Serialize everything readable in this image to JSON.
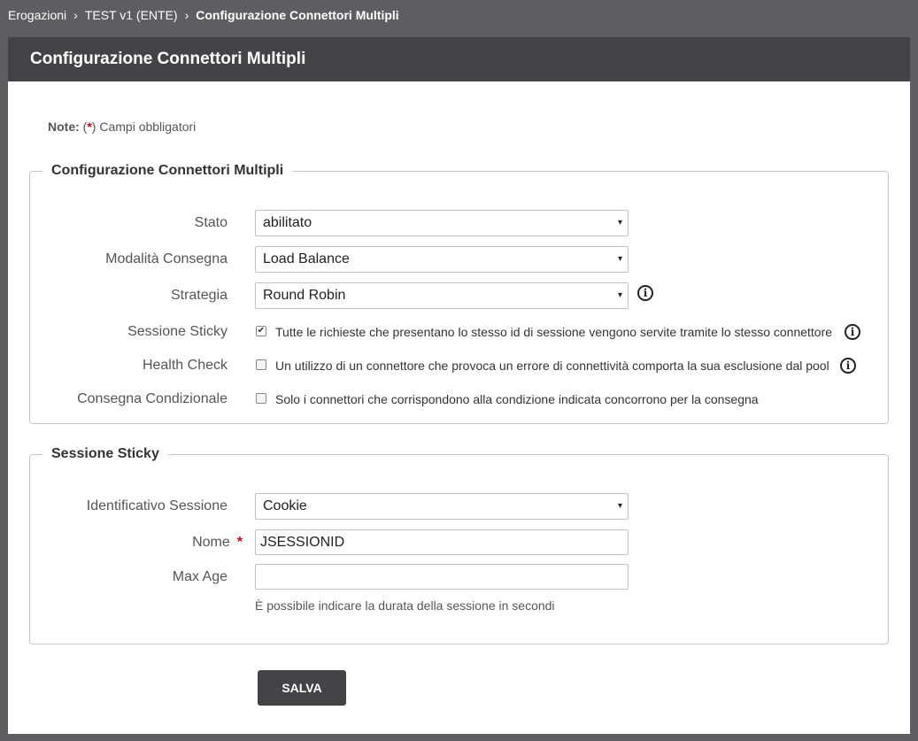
{
  "breadcrumb": {
    "items": [
      "Erogazioni",
      "TEST v1 (ENTE)"
    ],
    "current": "Configurazione Connettori Multipli",
    "separator": "›"
  },
  "panel": {
    "title": "Configurazione Connettori Multipli"
  },
  "note": {
    "label": "Note:",
    "open": "(",
    "star": "*",
    "close": ") Campi obbligatori"
  },
  "section1": {
    "legend": "Configurazione Connettori Multipli",
    "stato": {
      "label": "Stato",
      "value": "abilitato"
    },
    "modalita": {
      "label": "Modalità Consegna",
      "value": "Load Balance"
    },
    "strategia": {
      "label": "Strategia",
      "value": "Round Robin"
    },
    "sticky": {
      "label": "Sessione Sticky",
      "checked": true,
      "text": "Tutte le richieste che presentano lo stesso id di sessione vengono servite tramite lo stesso connettore"
    },
    "health": {
      "label": "Health Check",
      "checked": false,
      "text": "Un utilizzo di un connettore che provoca un errore di connettività comporta la sua esclusione dal pool"
    },
    "condizionale": {
      "label": "Consegna Condizionale",
      "checked": false,
      "text": "Solo i connettori che corrispondono alla condizione indicata concorrono per la consegna"
    }
  },
  "section2": {
    "legend": "Sessione Sticky",
    "identificativo": {
      "label": "Identificativo Sessione",
      "value": "Cookie"
    },
    "nome": {
      "label": "Nome",
      "required": "*",
      "value": "JSESSIONID"
    },
    "maxage": {
      "label": "Max Age",
      "value": "",
      "hint": "È possibile indicare la durata della sessione in secondi"
    }
  },
  "actions": {
    "save_label": "SALVA"
  },
  "icons": {
    "caret": "▾",
    "info": "i",
    "check": "✔"
  },
  "colors": {
    "header": "#434447",
    "background": "#5d5e61",
    "required": "#d0021b"
  }
}
